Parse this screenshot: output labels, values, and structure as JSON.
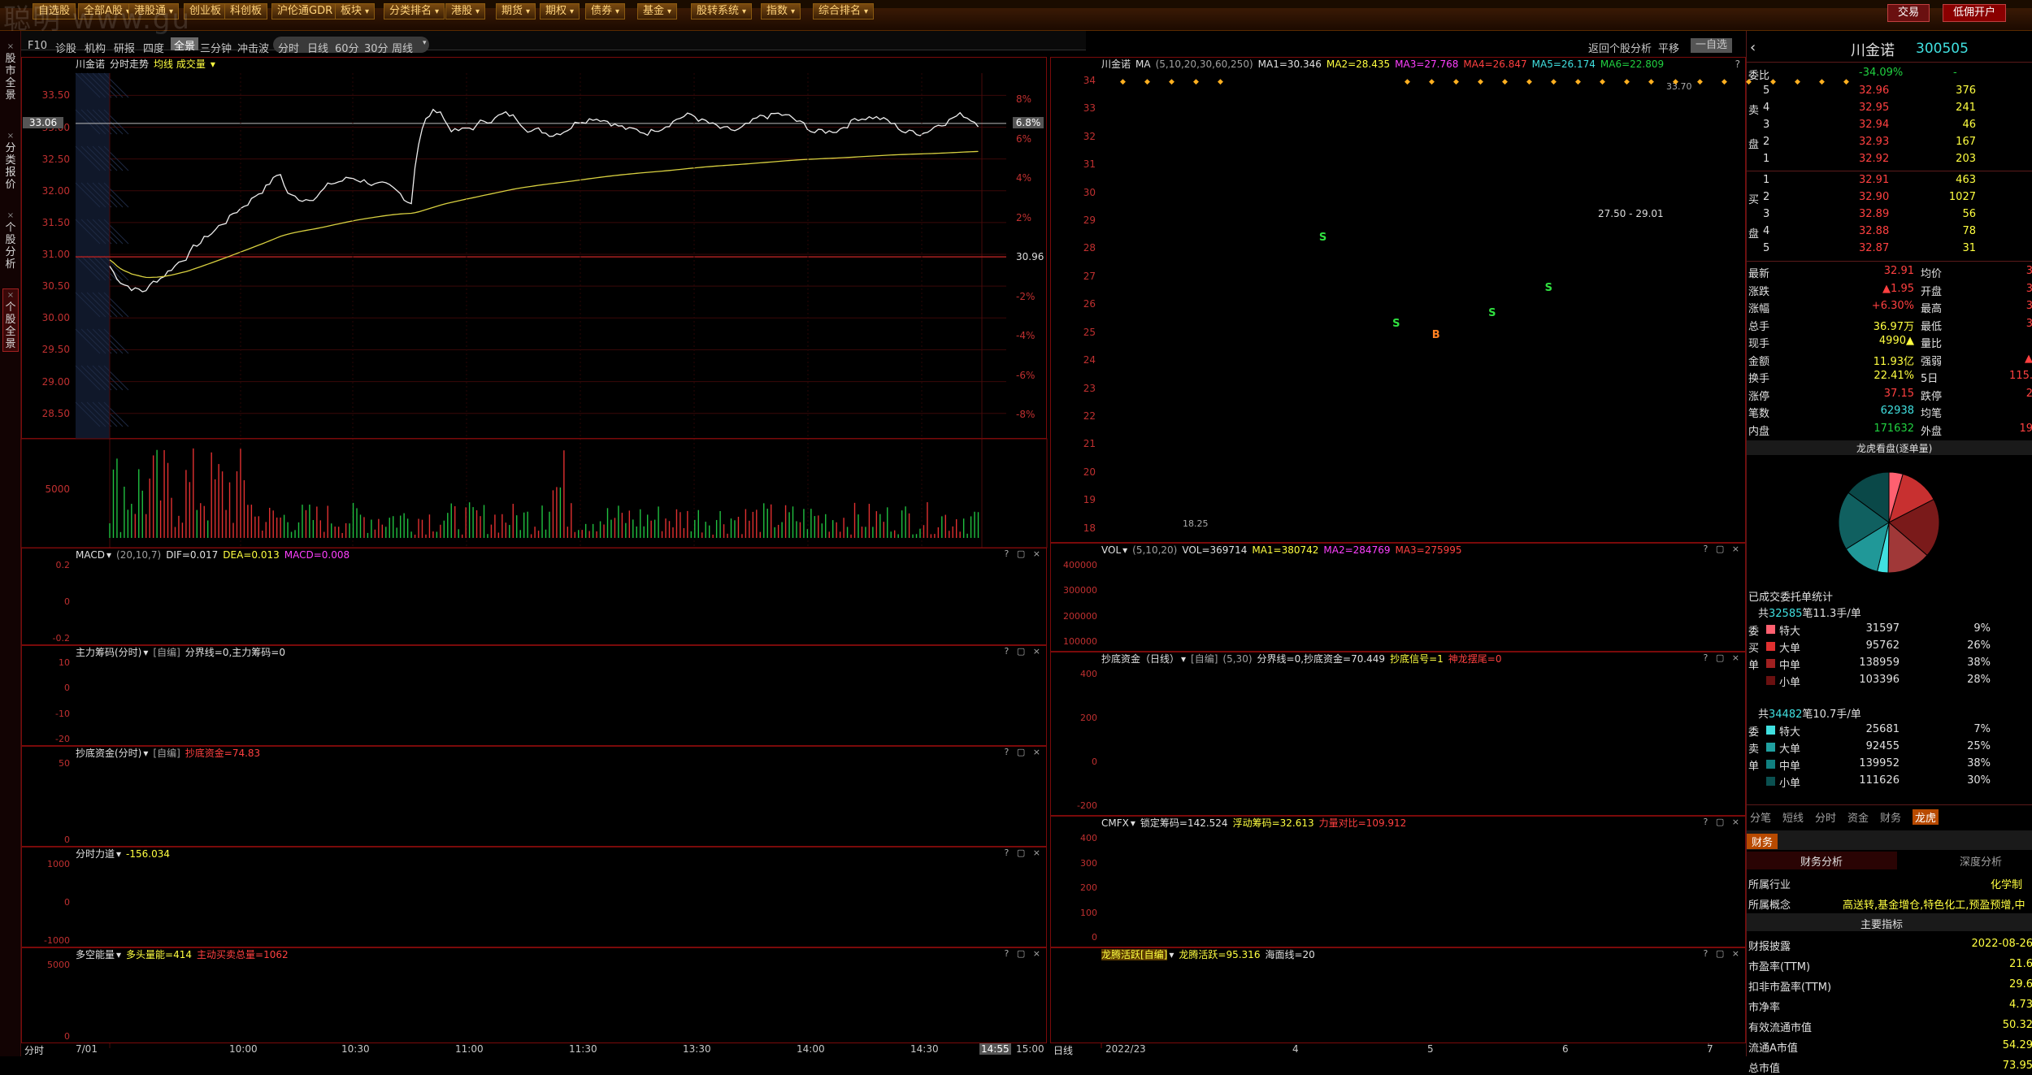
{
  "watermark": "聪明 www.gu",
  "toolbar": {
    "items": [
      {
        "label": "自选股",
        "caret": false
      },
      {
        "label": "全部A股",
        "caret": true
      },
      {
        "label": "港股通",
        "caret": true
      },
      {
        "label": "创业板",
        "caret": false
      },
      {
        "label": "科创板",
        "caret": false
      },
      {
        "label": "沪伦通GDR",
        "caret": false
      },
      {
        "label": "板块",
        "caret": true
      },
      {
        "label": "分类排名",
        "caret": true
      },
      {
        "label": "港股",
        "caret": true
      },
      {
        "label": "期货",
        "caret": true
      },
      {
        "label": "期权",
        "caret": true
      },
      {
        "label": "债券",
        "caret": true
      },
      {
        "label": "基金",
        "caret": true
      },
      {
        "label": "股转系统",
        "caret": true
      },
      {
        "label": "指数",
        "caret": true
      },
      {
        "label": "综合排名",
        "caret": true
      }
    ],
    "right": [
      "交易",
      "低佣开户"
    ]
  },
  "left_tabs": [
    "股市全景",
    "分类报价",
    "个股分析",
    "个股全景"
  ],
  "subbar": {
    "left": [
      "F10",
      "诊股",
      "机构",
      "研报",
      "四度",
      "全景",
      "三分钟",
      "冲击波"
    ],
    "periods": [
      "分时",
      "日线",
      "60分",
      "30分",
      "周线"
    ],
    "active": "全景",
    "right": [
      "返回个股分析",
      "平移",
      "一自选"
    ]
  },
  "intraday": {
    "header": {
      "name": "川金诺",
      "title": "分时走势",
      "extra": "均线 成交量"
    },
    "price_ticks": [
      "33.50",
      "33.00",
      "32.50",
      "32.00",
      "31.50",
      "31.00",
      "30.50",
      "30.00",
      "29.50",
      "29.00",
      "28.50"
    ],
    "pct_ticks": [
      "8%",
      "6%",
      "4%",
      "2%",
      "-2%",
      "-4%",
      "-6%",
      "-8%"
    ],
    "current_price": "33.06",
    "current_pct": "6.8%",
    "prev_close": "30.96",
    "vol_tick": "5000",
    "time_ticks": [
      "7/01",
      "10:00",
      "10:30",
      "11:00",
      "11:30",
      "13:30",
      "14:00",
      "14:30",
      "14:55",
      "15:00"
    ],
    "time_label": "分时"
  },
  "indicators_left": [
    {
      "name": "MACD",
      "params": "(20,10,7)",
      "values": [
        {
          "t": "DIF=0.017",
          "c": "wht"
        },
        {
          "t": "DEA=0.013",
          "c": "yel"
        },
        {
          "t": "MACD=0.008",
          "c": "mag"
        }
      ],
      "ticks": [
        "0.2",
        "0",
        "-0.2"
      ]
    },
    {
      "name": "主力筹码(分时)",
      "params": "[自编]",
      "values": [
        {
          "t": "分界线=0,主力筹码=0",
          "c": "wht"
        }
      ],
      "ticks": [
        "10",
        "0",
        "-10",
        "-20"
      ]
    },
    {
      "name": "抄底资金(分时)",
      "params": "[自编]",
      "values": [
        {
          "t": "抄底资金=74.83",
          "c": "red"
        }
      ],
      "ticks": [
        "50",
        "0"
      ]
    },
    {
      "name": "分时力道",
      "params": "",
      "values": [
        {
          "t": "-156.034",
          "c": "yel"
        }
      ],
      "ticks": [
        "1000",
        "0",
        "-1000"
      ]
    },
    {
      "name": "多空能量",
      "params": "",
      "values": [
        {
          "t": "多头量能=414",
          "c": "yel"
        },
        {
          "t": "主动买卖总量=1062",
          "c": "red"
        }
      ],
      "ticks": [
        "5000",
        "0"
      ]
    }
  ],
  "kline": {
    "header": {
      "name": "川金诺",
      "ma": "MA",
      "params": "(5,10,20,30,60,250)",
      "values": [
        {
          "t": "MA1=30.346",
          "c": "wht"
        },
        {
          "t": "MA2=28.435",
          "c": "yel"
        },
        {
          "t": "MA3=27.768",
          "c": "mag"
        },
        {
          "t": "MA4=26.847",
          "c": "red"
        },
        {
          "t": "MA5=26.174",
          "c": "cyan"
        },
        {
          "t": "MA6=22.809",
          "c": "grn"
        }
      ]
    },
    "price_ticks": [
      "34",
      "33",
      "32",
      "31",
      "30",
      "29",
      "28",
      "27",
      "26",
      "25",
      "24",
      "23",
      "22",
      "21",
      "20",
      "19",
      "18"
    ],
    "annot_high": "33.70",
    "annot_low": "18.25",
    "range_label": "27.50 - 29.01",
    "x_ticks": [
      "2022/2",
      "3",
      "4",
      "5",
      "6",
      "7"
    ],
    "x_label": "日线"
  },
  "indicators_right": [
    {
      "name": "VOL",
      "params": "(5,10,20)",
      "values": [
        {
          "t": "VOL=369714",
          "c": "wht"
        },
        {
          "t": "MA1=380742",
          "c": "yel"
        },
        {
          "t": "MA2=284769",
          "c": "mag"
        },
        {
          "t": "MA3=275995",
          "c": "red"
        }
      ],
      "ticks": [
        "400000",
        "300000",
        "200000",
        "100000"
      ]
    },
    {
      "name": "抄底资金（日线）",
      "params": "[自编]",
      "values": [
        {
          "t": "(5,30)",
          "c": "gry"
        },
        {
          "t": "分界线=0,抄底资金=70.449",
          "c": "wht"
        },
        {
          "t": "抄底信号=1",
          "c": "yel"
        },
        {
          "t": "神龙摆尾=0",
          "c": "red"
        }
      ],
      "ticks": [
        "400",
        "200",
        "0",
        "-200"
      ]
    },
    {
      "name": "CMFX",
      "params": "",
      "values": [
        {
          "t": "锁定筹码=142.524",
          "c": "wht"
        },
        {
          "t": "浮动筹码=32.613",
          "c": "yel"
        },
        {
          "t": "力量对比=109.912",
          "c": "red"
        }
      ],
      "ticks": [
        "400",
        "300",
        "200",
        "100",
        "0"
      ]
    },
    {
      "name": "龙腾活跃[自编]",
      "params": "",
      "values": [
        {
          "t": "龙腾活跃=95.316",
          "c": "yel"
        },
        {
          "t": "海面线=20",
          "c": "wht"
        }
      ],
      "ticks": []
    }
  ],
  "quote": {
    "name": "川金诺",
    "code": "300505",
    "weibi": {
      "label": "委比",
      "value": "-34.09%",
      "num": "-"
    },
    "asks": [
      {
        "lv": "5",
        "p": "32.96",
        "v": "376"
      },
      {
        "lv": "4",
        "p": "32.95",
        "v": "241"
      },
      {
        "lv": "3",
        "p": "32.94",
        "v": "46"
      },
      {
        "lv": "2",
        "p": "32.93",
        "v": "167"
      },
      {
        "lv": "1",
        "p": "32.92",
        "v": "203"
      }
    ],
    "bids": [
      {
        "lv": "1",
        "p": "32.91",
        "v": "463"
      },
      {
        "lv": "2",
        "p": "32.90",
        "v": "1027"
      },
      {
        "lv": "3",
        "p": "32.89",
        "v": "56"
      },
      {
        "lv": "4",
        "p": "32.88",
        "v": "78"
      },
      {
        "lv": "5",
        "p": "32.87",
        "v": "31"
      }
    ],
    "stats": [
      {
        "l": "最新",
        "v": "32.91",
        "c": "red",
        "l2": "均价",
        "v2": "3"
      },
      {
        "l": "涨跌",
        "v": "▲1.95",
        "c": "red",
        "l2": "开盘",
        "v2": "3"
      },
      {
        "l": "涨幅",
        "v": "+6.30%",
        "c": "red",
        "l2": "最高",
        "v2": "3"
      },
      {
        "l": "总手",
        "v": "36.97万",
        "c": "yel",
        "l2": "最低",
        "v2": "3"
      },
      {
        "l": "现手",
        "v": "4990▲",
        "c": "yel",
        "l2": "量比",
        "v2": ""
      },
      {
        "l": "金额",
        "v": "11.93亿",
        "c": "yel",
        "l2": "强弱",
        "v2": "▲"
      },
      {
        "l": "换手",
        "v": "22.41%",
        "c": "yel",
        "l2": "5日",
        "v2": "115."
      },
      {
        "l": "涨停",
        "v": "37.15",
        "c": "red",
        "l2": "跌停",
        "v2": "2"
      },
      {
        "l": "笔数",
        "v": "62938",
        "c": "cyan",
        "l2": "均笔",
        "v2": ""
      },
      {
        "l": "内盘",
        "v": "171632",
        "c": "grn",
        "l2": "外盘",
        "v2": "19"
      }
    ],
    "pie_title": "龙虎看盘(逐单量)",
    "pie": [
      {
        "v": 9,
        "c": "#ff6070"
      },
      {
        "v": 26,
        "c": "#c83030"
      },
      {
        "v": 38,
        "c": "#7a1a1a"
      },
      {
        "v": 28,
        "c": "#a03838"
      },
      {
        "v": 7,
        "c": "#40e0e0"
      },
      {
        "v": 25,
        "c": "#209898"
      },
      {
        "v": 38,
        "c": "#106060"
      },
      {
        "v": 30,
        "c": "#0a4848"
      }
    ],
    "orders_title": "已成交委托单统计",
    "buy_total": {
      "pre": "共",
      "n": "32585",
      "suf": "笔11.3手/单"
    },
    "buy": [
      {
        "k": "特大",
        "n": "31597",
        "p": "9%"
      },
      {
        "k": "大单",
        "n": "95762",
        "p": "26%"
      },
      {
        "k": "中单",
        "n": "138959",
        "p": "38%"
      },
      {
        "k": "小单",
        "n": "103396",
        "p": "28%"
      }
    ],
    "buy_side": [
      "委",
      "买",
      "单"
    ],
    "sell_total": {
      "pre": "共",
      "n": "34482",
      "suf": "笔10.7手/单"
    },
    "sell": [
      {
        "k": "特大",
        "n": "25681",
        "p": "7%"
      },
      {
        "k": "大单",
        "n": "92455",
        "p": "25%"
      },
      {
        "k": "中单",
        "n": "139952",
        "p": "38%"
      },
      {
        "k": "小单",
        "n": "111626",
        "p": "30%"
      }
    ],
    "sell_side": [
      "委",
      "卖",
      "单"
    ],
    "tabs": [
      "分笔",
      "短线",
      "分时",
      "资金",
      "财务",
      "龙虎"
    ],
    "fin_tab": "财务",
    "fin_sub": [
      "财务分析",
      "深度分析"
    ],
    "industry": {
      "l": "所属行业",
      "v": "化学制"
    },
    "concept": {
      "l": "所属概念",
      "v": "高送转,基金增仓,特色化工,预盈预增,中"
    },
    "main_title": "主要指标",
    "rows": [
      {
        "l": "财报披露",
        "v": "2022-08-26"
      },
      {
        "l": "市盈率(TTM)",
        "v": "21.6"
      },
      {
        "l": "扣非市盈率(TTM)",
        "v": "29.6"
      },
      {
        "l": "市净率",
        "v": "4.73"
      },
      {
        "l": "有效流通市值",
        "v": "50.32"
      },
      {
        "l": "流通A市值",
        "v": "54.29"
      },
      {
        "l": "总市值",
        "v": "73.95"
      }
    ],
    "ask_side": [
      "卖",
      "盘"
    ],
    "bid_side": [
      "买",
      "盘"
    ]
  }
}
